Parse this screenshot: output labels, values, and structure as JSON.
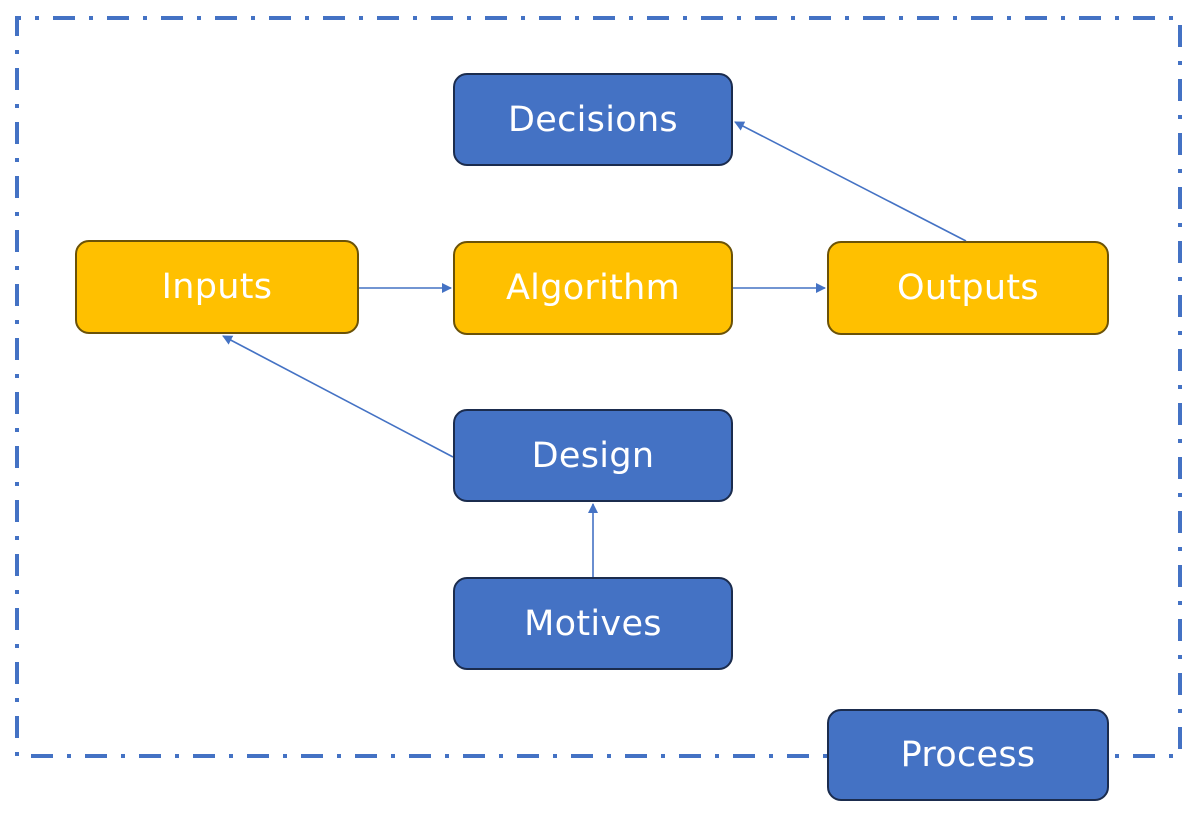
{
  "diagram": {
    "type": "flow",
    "colors": {
      "blue_fill": "#4472c4",
      "blue_border": "#1b2c4e",
      "yellow_fill": "#ffc000",
      "yellow_border": "#6b5207",
      "connector": "#4472c4",
      "boundary": "#4472c4",
      "text": "#ffffff"
    },
    "boundary": {
      "style": "dash-dot",
      "label_node": "process"
    },
    "nodes": [
      {
        "id": "decisions",
        "label": "Decisions",
        "color": "blue"
      },
      {
        "id": "inputs",
        "label": "Inputs",
        "color": "yellow"
      },
      {
        "id": "algorithm",
        "label": "Algorithm",
        "color": "yellow"
      },
      {
        "id": "outputs",
        "label": "Outputs",
        "color": "yellow"
      },
      {
        "id": "design",
        "label": "Design",
        "color": "blue"
      },
      {
        "id": "motives",
        "label": "Motives",
        "color": "blue"
      },
      {
        "id": "process",
        "label": "Process",
        "color": "blue"
      }
    ],
    "edges": [
      {
        "from": "inputs",
        "to": "algorithm"
      },
      {
        "from": "algorithm",
        "to": "outputs"
      },
      {
        "from": "outputs",
        "to": "decisions"
      },
      {
        "from": "design",
        "to": "inputs"
      },
      {
        "from": "motives",
        "to": "design"
      }
    ]
  }
}
